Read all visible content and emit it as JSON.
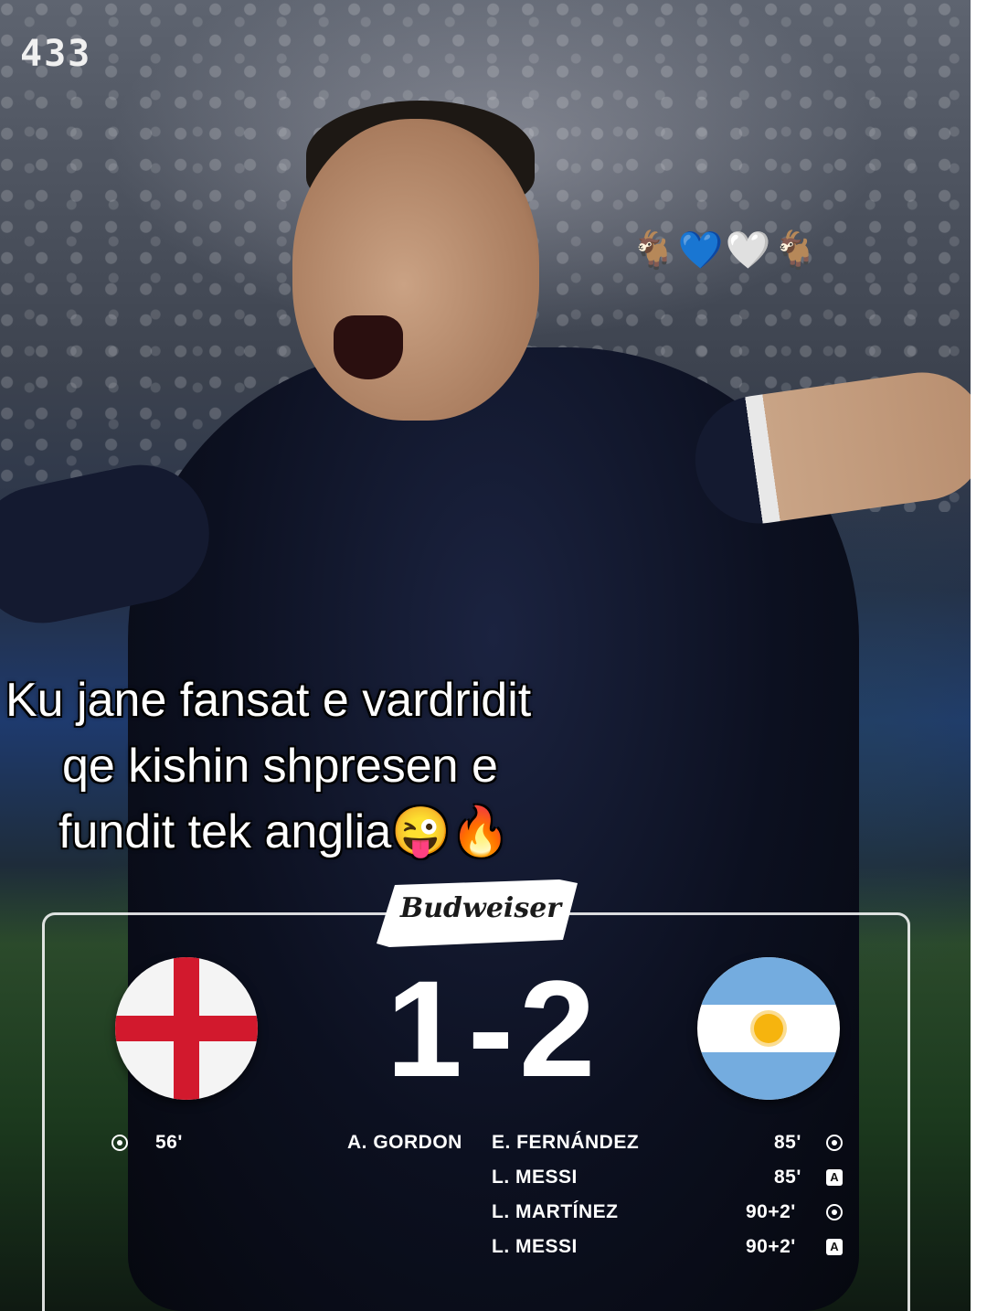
{
  "brand": {
    "logo_text": "433"
  },
  "decor": {
    "emojis": "🐐💙🤍🐐"
  },
  "caption": {
    "line1": "Ku jane fansat e vardridit",
    "line2": "qe kishin shpresen e",
    "line3": "fundit tek anglia😜🔥"
  },
  "sponsor": {
    "name": "Budweiser"
  },
  "match": {
    "home_team_flag": "england-flag",
    "away_team_flag": "argentina-flag",
    "home_score": "1",
    "separator": "-",
    "away_score": "2",
    "score_display": "1-2",
    "home_events": [
      {
        "minute": "56'",
        "player": "A. GORDON",
        "type": "goal-icon"
      }
    ],
    "away_events": [
      {
        "player": "E. FERNÁNDEZ",
        "minute": "85'",
        "type": "goal-icon"
      },
      {
        "player": "L. MESSI",
        "minute": "85'",
        "type": "assist-icon"
      },
      {
        "player": "L. MARTÍNEZ",
        "minute": "90+2'",
        "type": "goal-icon"
      },
      {
        "player": "L. MESSI",
        "minute": "90+2'",
        "type": "assist-icon"
      }
    ],
    "assist_glyph": "A"
  },
  "colors": {
    "england_red": "#d2192d",
    "argentina_blue": "#74acdf",
    "argentina_sun": "#f6b40e",
    "text": "#ffffff"
  }
}
